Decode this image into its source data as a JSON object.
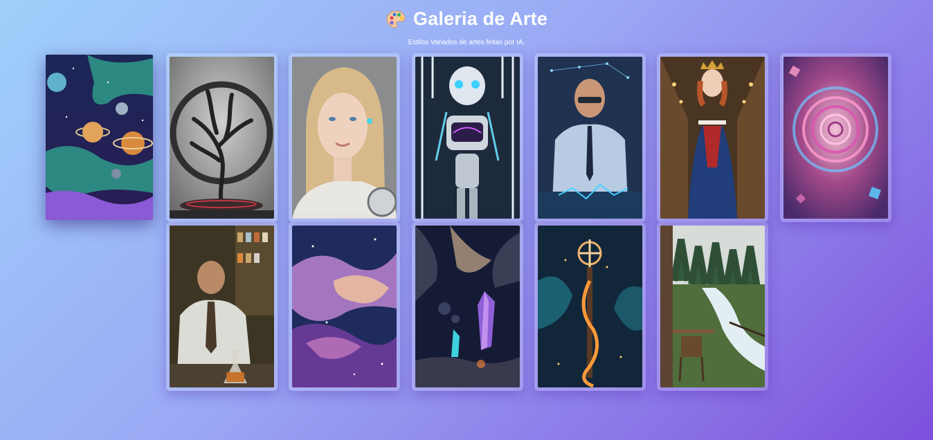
{
  "header": {
    "title": "Galeria de Arte",
    "subtitle": "Estilos Variados de artes feitas por IA.",
    "icon": "palette-icon"
  },
  "gallery": {
    "rows": [
      [
        "planets-space",
        "dark-tree-circle",
        "blonde-android-woman",
        "humanoid-robot",
        "man-with-glasses-holograms",
        "queen-in-palace",
        "fractal-spiral"
      ],
      [
        "scientist-laboratory",
        "purple-nebula",
        "crystals-asteroids",
        "mystic-staff-fire",
        "forest-river-balcony"
      ]
    ],
    "hovered_item": "planets-space"
  },
  "colors": {
    "background_start": "#9fd0fb",
    "background_end": "#7d4fdc",
    "title": "#ffffff"
  }
}
